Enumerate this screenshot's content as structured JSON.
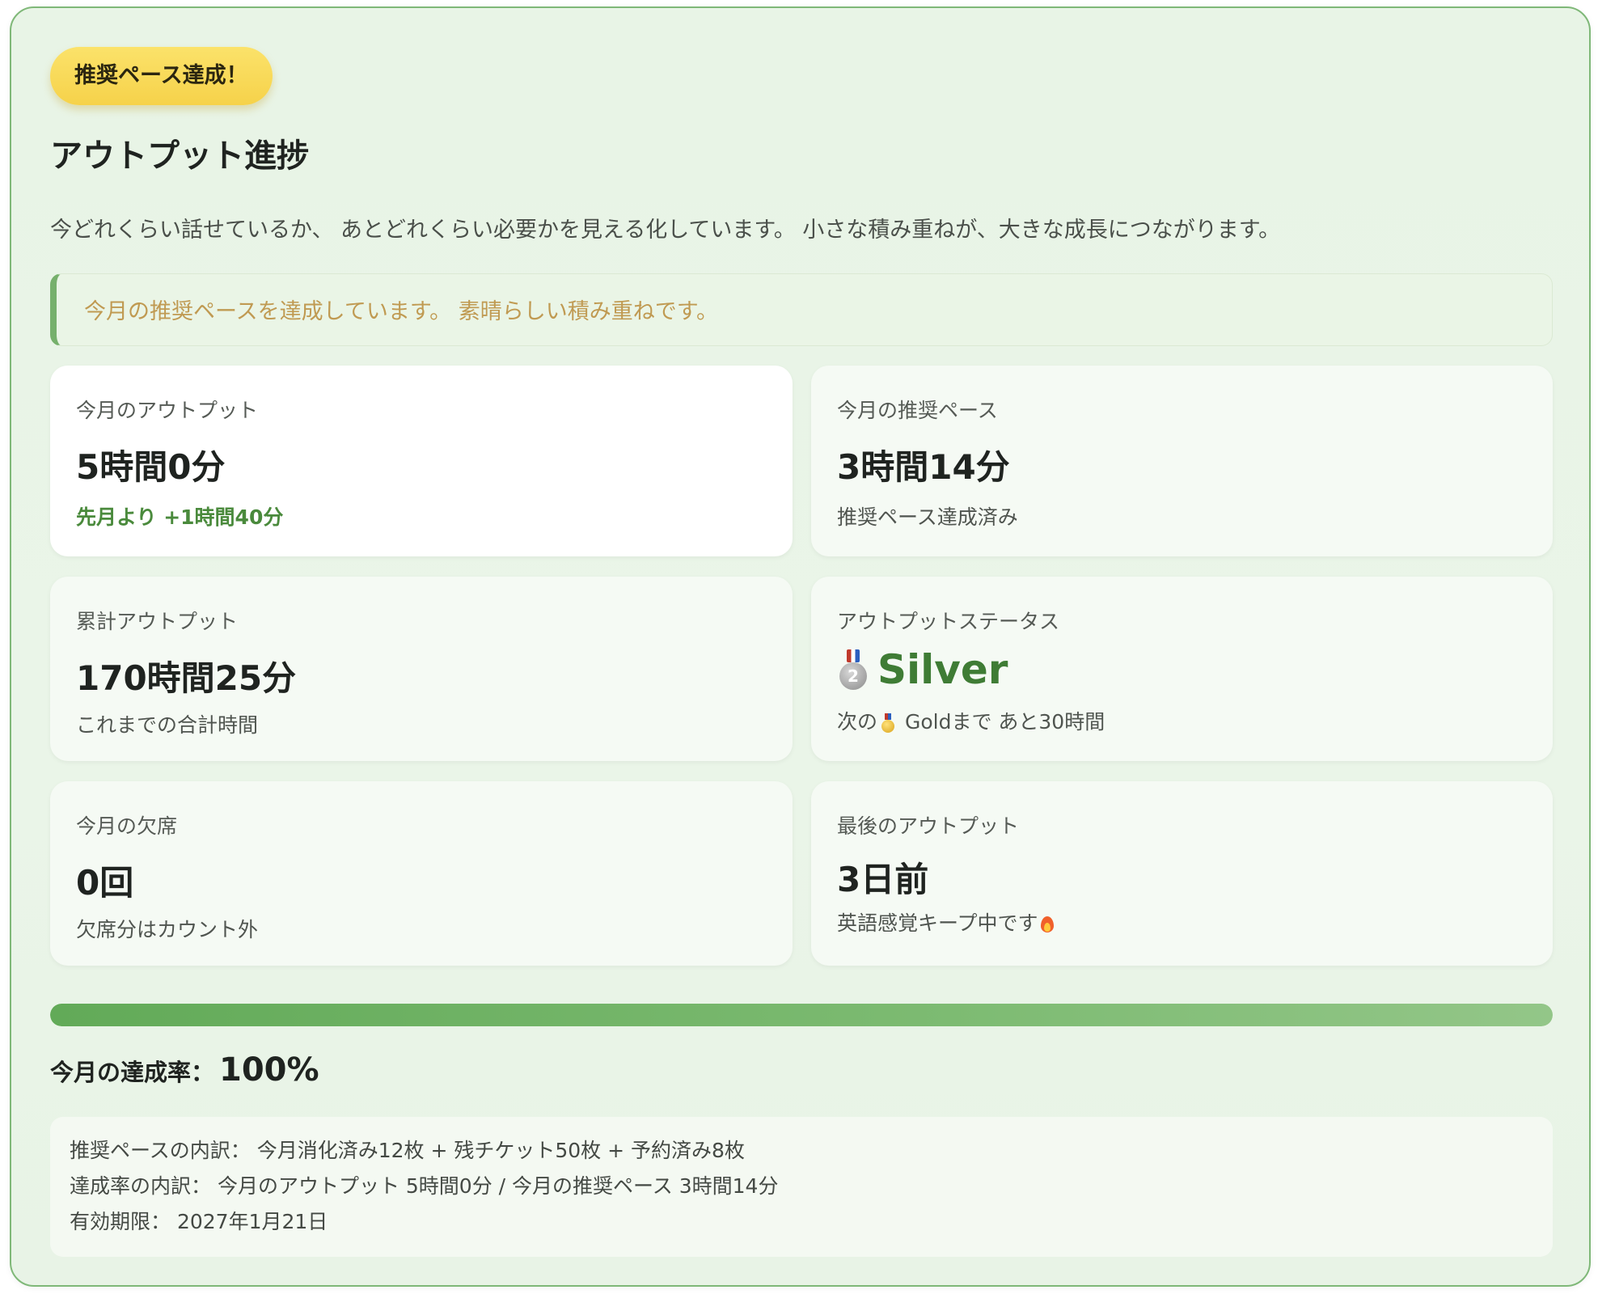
{
  "badge": {
    "label": "推奨ペース達成！"
  },
  "header": {
    "title": "アウトプット進捗",
    "subtitle": "今どれくらい話せているか、 あとどれくらい必要かを見える化しています。 小さな積み重ねが、大きな成長につながります。"
  },
  "notice": {
    "text": "今月の推奨ペースを達成しています。 素晴らしい積み重ねです。"
  },
  "cards": {
    "monthly_output": {
      "label": "今月のアウトプット",
      "value": "5時間0分",
      "sub": "先月より +1時間40分"
    },
    "recommended_pace": {
      "label": "今月の推奨ペース",
      "value": "3時間14分",
      "sub": "推奨ペース達成済み"
    },
    "total_output": {
      "label": "累計アウトプット",
      "value": "170時間25分",
      "sub": "これまでの合計時間"
    },
    "status": {
      "label": "アウトプットステータス",
      "icon": "silver-medal-icon",
      "medal_number": "2",
      "value": "Silver",
      "sub_prefix": "次の",
      "sub_icon": "gold-medal-icon",
      "sub_suffix": " Goldまで あと30時間"
    },
    "absence": {
      "label": "今月の欠席",
      "value": "0回",
      "sub": "欠席分はカウント外"
    },
    "last_output": {
      "label": "最後のアウトプット",
      "value": "3日前",
      "sub": "英語感覚キープ中です",
      "sub_icon": "fire-icon"
    }
  },
  "progress": {
    "percent": 100,
    "label": "今月の達成率：",
    "value": "100%"
  },
  "details": {
    "line1": "推奨ペースの内訳： 今月消化済み12枚 + 残チケット50枚 + 予約済み8枚",
    "line2": "達成率の内訳： 今月のアウトプット 5時間0分 / 今月の推奨ペース 3時間14分",
    "line3": "有効期限： 2027年1月21日"
  },
  "colors": {
    "accent_green": "#4a8a3c",
    "badge_yellow": "#f6d24a",
    "notice_text": "#c09a52",
    "panel_border": "#7fb878"
  }
}
